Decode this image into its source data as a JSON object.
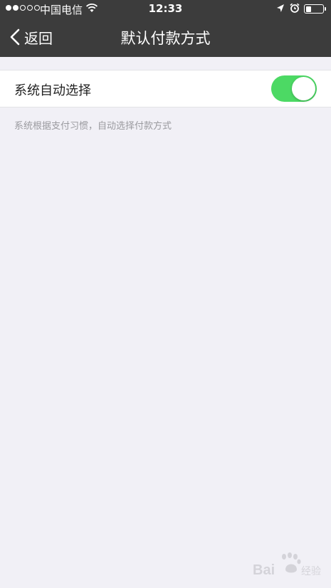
{
  "status_bar": {
    "carrier": "中国电信",
    "time": "12:33",
    "battery_level": 0.35
  },
  "nav": {
    "back_label": "返回",
    "title": "默认付款方式"
  },
  "settings": {
    "auto_select_label": "系统自动选择",
    "auto_select_on": true,
    "footnote": "系统根据支付习惯，自动选择付款方式"
  },
  "watermark": {
    "text": "Bai 经验"
  },
  "colors": {
    "nav_bg": "#3c3c3c",
    "page_bg": "#f1f0f6",
    "toggle_on": "#4cd964"
  }
}
